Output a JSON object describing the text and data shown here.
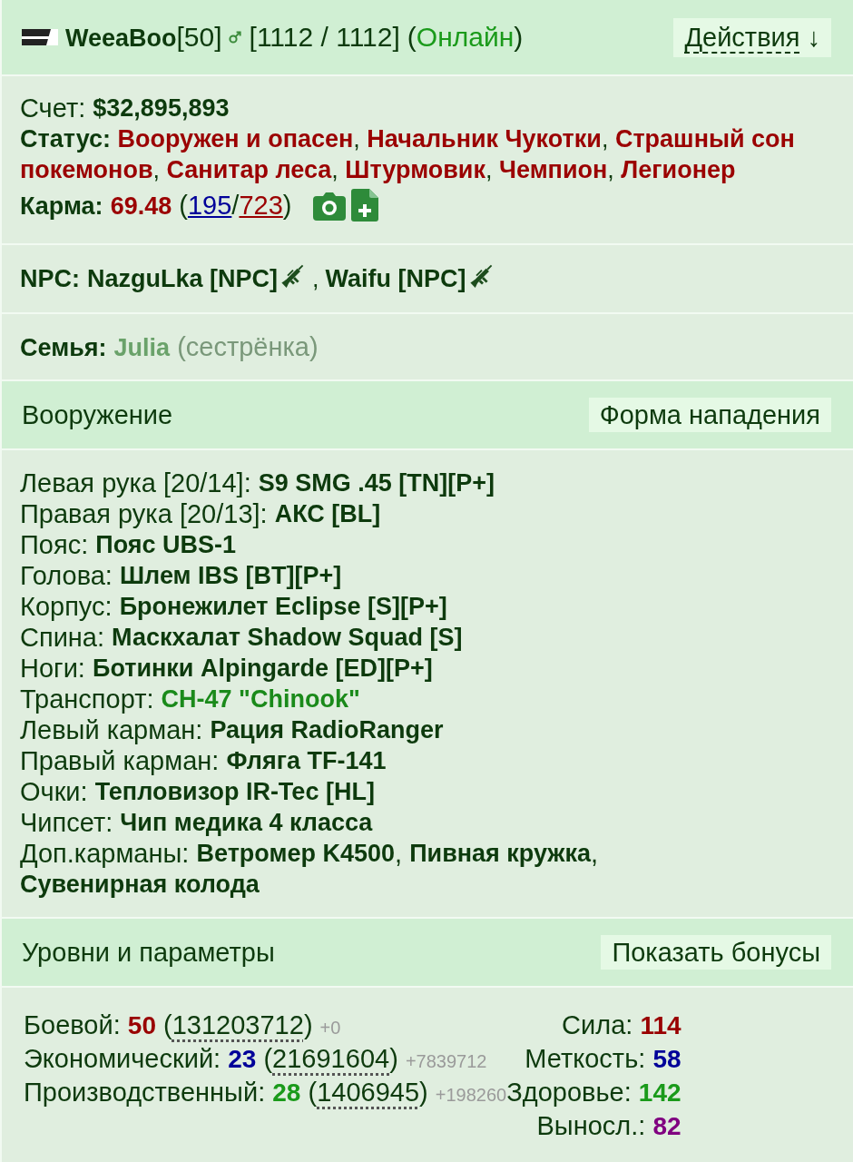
{
  "header": {
    "name": "WeeaBoo",
    "level": "[50]",
    "hp": "[1112 / 1112]",
    "presence": {
      "open": "(",
      "label": "Онлайн",
      "close": ")"
    },
    "actions_button": {
      "label": "Действия",
      "arrow": "↓"
    }
  },
  "summary": {
    "account": {
      "label": "Счет:",
      "value": "$32,895,893"
    },
    "status": {
      "label": "Статус:",
      "separator": ", ",
      "items": [
        "Вооружен и опасен",
        "Начальник Чукотки",
        "Страшный сон покемонов",
        "Санитар леса",
        "Штурмовик",
        "Чемпион",
        "Легионер"
      ]
    },
    "karma": {
      "label": "Карма:",
      "value": "69.48",
      "open": "(",
      "positive": "195",
      "divider": "/",
      "negative": "723",
      "close": ")"
    }
  },
  "npc": {
    "label": "NPC:",
    "separator": ",",
    "items": [
      "NazguLka [NPC]",
      "Waifu [NPC]"
    ]
  },
  "family": {
    "label": "Семья:",
    "name": "Julia",
    "relation": "(сестрёнка)"
  },
  "equipment": {
    "title": "Вооружение",
    "button": "Форма нападения",
    "separator": ", ",
    "slots": [
      {
        "label": "Левая рука [20/14]:",
        "kind": "item",
        "items": [
          "S9 SMG .45 [TN][P+]"
        ]
      },
      {
        "label": "Правая рука [20/13]:",
        "kind": "item",
        "items": [
          "АКС [BL]"
        ]
      },
      {
        "label": "Пояс:",
        "kind": "item",
        "items": [
          "Пояс UBS-1"
        ]
      },
      {
        "label": "Голова:",
        "kind": "item",
        "items": [
          "Шлем IBS [BT][P+]"
        ]
      },
      {
        "label": "Корпус:",
        "kind": "item",
        "items": [
          "Бронежилет Eclipse [S][P+]"
        ]
      },
      {
        "label": "Спина:",
        "kind": "item",
        "items": [
          "Маскхалат Shadow Squad [S]"
        ]
      },
      {
        "label": "Ноги:",
        "kind": "item",
        "items": [
          "Ботинки Alpingarde [ED][P+]"
        ]
      },
      {
        "label": "Транспорт:",
        "kind": "vehicle",
        "items": [
          "CH-47 \"Chinook\""
        ]
      },
      {
        "label": "Левый карман:",
        "kind": "item",
        "items": [
          "Рация RadioRanger"
        ]
      },
      {
        "label": "Правый карман:",
        "kind": "item",
        "items": [
          "Фляга TF-141"
        ]
      },
      {
        "label": "Очки:",
        "kind": "item",
        "items": [
          "Тепловизор IR-Tec [HL]"
        ]
      },
      {
        "label": "Чипсет:",
        "kind": "item",
        "items": [
          "Чип медика 4 класса"
        ]
      },
      {
        "label": "Доп.карманы:",
        "kind": "item",
        "items": [
          "Ветромер K4500",
          "Пивная кружка",
          "Сувенирная колода"
        ]
      }
    ]
  },
  "levels": {
    "title": "Уровни и параметры",
    "button": "Показать бонусы",
    "skills": [
      {
        "label": "Боевой:",
        "level": "50",
        "color": "#990000",
        "open": "(",
        "xp": "131203712",
        "close": ")",
        "bonus": "+0"
      },
      {
        "label": "Экономический:",
        "level": "23",
        "color": "#000099",
        "open": "(",
        "xp": "21691604",
        "close": ")",
        "bonus": "+7839712"
      },
      {
        "label": "Производственный:",
        "level": "28",
        "color": "#1a9a1a",
        "open": "(",
        "xp": "1406945",
        "close": ")",
        "bonus": "+198260"
      }
    ],
    "attributes": [
      {
        "label": "Сила:",
        "value": "114",
        "color": "#990000"
      },
      {
        "label": "Меткость:",
        "value": "58",
        "color": "#000099"
      },
      {
        "label": "Здоровье:",
        "value": "142",
        "color": "#1a9a1a"
      },
      {
        "label": "Выносл.:",
        "value": "82",
        "color": "#800080"
      }
    ]
  }
}
